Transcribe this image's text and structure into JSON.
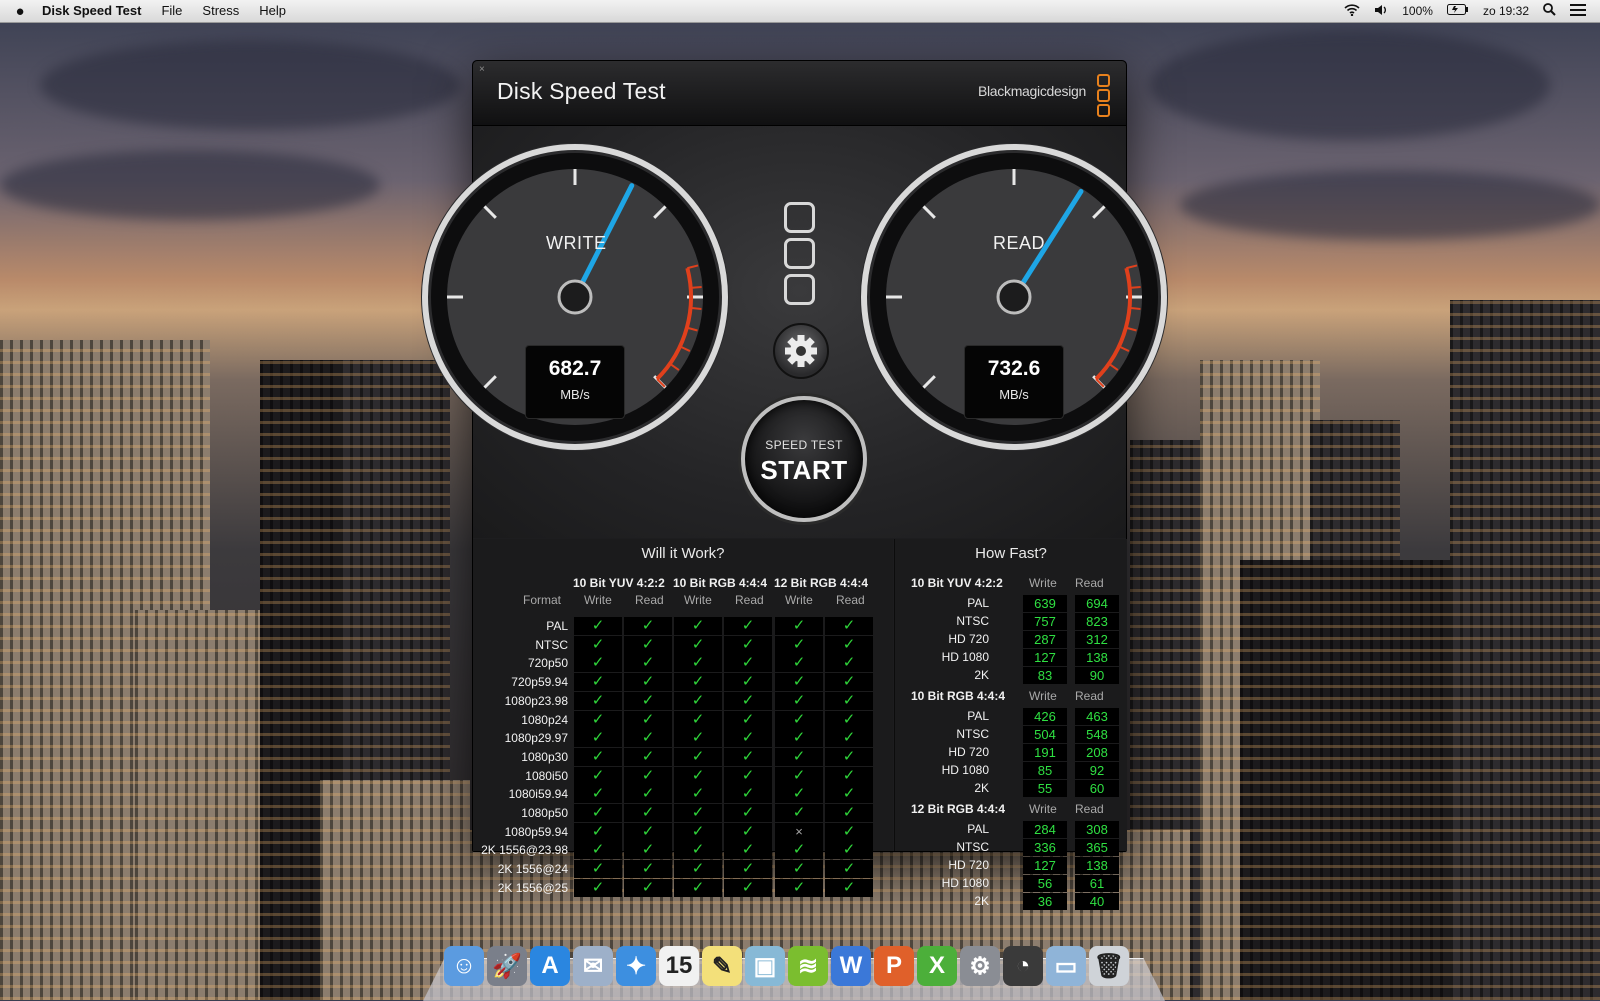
{
  "menubar": {
    "apple": "",
    "app_name": "Disk Speed Test",
    "menus": [
      "File",
      "Stress",
      "Help"
    ],
    "battery": "100%",
    "clock": "zo 19:32"
  },
  "window": {
    "close_glyph": "×",
    "title": "Disk Speed Test",
    "brand": "Blackmagicdesign",
    "accent_color": "#e8811d"
  },
  "gauges": {
    "write": {
      "label": "WRITE",
      "value": "682.7",
      "unit": "MB/s",
      "needle_fraction": 0.6
    },
    "read": {
      "label": "READ",
      "value": "732.6",
      "unit": "MB/s",
      "needle_fraction": 0.62
    }
  },
  "start_button": {
    "line1": "SPEED TEST",
    "line2": "START"
  },
  "will_it_work": {
    "title": "Will it Work?",
    "format_label": "Format",
    "groups": [
      "10 Bit YUV 4:2:2",
      "10 Bit RGB 4:4:4",
      "12 Bit RGB 4:4:4"
    ],
    "subcols": [
      "Write",
      "Read"
    ],
    "rows": [
      {
        "fmt": "PAL",
        "r": [
          1,
          1,
          1,
          1,
          1,
          1
        ]
      },
      {
        "fmt": "NTSC",
        "r": [
          1,
          1,
          1,
          1,
          1,
          1
        ]
      },
      {
        "fmt": "720p50",
        "r": [
          1,
          1,
          1,
          1,
          1,
          1
        ]
      },
      {
        "fmt": "720p59.94",
        "r": [
          1,
          1,
          1,
          1,
          1,
          1
        ]
      },
      {
        "fmt": "1080p23.98",
        "r": [
          1,
          1,
          1,
          1,
          1,
          1
        ]
      },
      {
        "fmt": "1080p24",
        "r": [
          1,
          1,
          1,
          1,
          1,
          1
        ]
      },
      {
        "fmt": "1080p29.97",
        "r": [
          1,
          1,
          1,
          1,
          1,
          1
        ]
      },
      {
        "fmt": "1080p30",
        "r": [
          1,
          1,
          1,
          1,
          1,
          1
        ]
      },
      {
        "fmt": "1080i50",
        "r": [
          1,
          1,
          1,
          1,
          1,
          1
        ]
      },
      {
        "fmt": "1080i59.94",
        "r": [
          1,
          1,
          1,
          1,
          1,
          1
        ]
      },
      {
        "fmt": "1080p50",
        "r": [
          1,
          1,
          1,
          1,
          1,
          1
        ]
      },
      {
        "fmt": "1080p59.94",
        "r": [
          1,
          1,
          1,
          1,
          0,
          1
        ]
      },
      {
        "fmt": "2K 1556@23.98",
        "r": [
          1,
          1,
          1,
          1,
          1,
          1
        ]
      },
      {
        "fmt": "2K 1556@24",
        "r": [
          1,
          1,
          1,
          1,
          1,
          1
        ]
      },
      {
        "fmt": "2K 1556@25",
        "r": [
          1,
          1,
          1,
          1,
          1,
          1
        ]
      }
    ],
    "ok_glyph": "✓",
    "fail_glyph": "×"
  },
  "how_fast": {
    "title": "How Fast?",
    "subcols": [
      "Write",
      "Read"
    ],
    "groups": [
      {
        "name": "10 Bit YUV 4:2:2",
        "rows": [
          {
            "fmt": "PAL",
            "w": "639",
            "r": "694"
          },
          {
            "fmt": "NTSC",
            "w": "757",
            "r": "823"
          },
          {
            "fmt": "HD 720",
            "w": "287",
            "r": "312"
          },
          {
            "fmt": "HD 1080",
            "w": "127",
            "r": "138"
          },
          {
            "fmt": "2K",
            "w": "83",
            "r": "90"
          }
        ]
      },
      {
        "name": "10 Bit RGB 4:4:4",
        "rows": [
          {
            "fmt": "PAL",
            "w": "426",
            "r": "463"
          },
          {
            "fmt": "NTSC",
            "w": "504",
            "r": "548"
          },
          {
            "fmt": "HD 720",
            "w": "191",
            "r": "208"
          },
          {
            "fmt": "HD 1080",
            "w": "85",
            "r": "92"
          },
          {
            "fmt": "2K",
            "w": "55",
            "r": "60"
          }
        ]
      },
      {
        "name": "12 Bit RGB 4:4:4",
        "rows": [
          {
            "fmt": "PAL",
            "w": "284",
            "r": "308"
          },
          {
            "fmt": "NTSC",
            "w": "336",
            "r": "365"
          },
          {
            "fmt": "HD 720",
            "w": "127",
            "r": "138"
          },
          {
            "fmt": "HD 1080",
            "w": "56",
            "r": "61"
          },
          {
            "fmt": "2K",
            "w": "36",
            "r": "40"
          }
        ]
      }
    ]
  },
  "dock": {
    "items": [
      {
        "name": "finder-icon",
        "glyph": "☺",
        "color": "#5b9be0"
      },
      {
        "name": "launchpad-icon",
        "glyph": "🚀",
        "color": "#7a7f8a"
      },
      {
        "name": "app-store-icon",
        "glyph": "A",
        "color": "#2a86e0"
      },
      {
        "name": "mail-icon",
        "glyph": "✉",
        "color": "#9db0c9"
      },
      {
        "name": "safari-icon",
        "glyph": "✦",
        "color": "#3d8fe0"
      },
      {
        "name": "calendar-icon",
        "glyph": "15",
        "color": "#f1f1f1"
      },
      {
        "name": "notes-icon",
        "glyph": "✎",
        "color": "#f3e07a"
      },
      {
        "name": "preview-icon",
        "glyph": "▣",
        "color": "#87b9d6"
      },
      {
        "name": "spotify-icon",
        "glyph": "≋",
        "color": "#7bbe2f"
      },
      {
        "name": "word-icon",
        "glyph": "W",
        "color": "#3b78d8"
      },
      {
        "name": "powerpoint-icon",
        "glyph": "P",
        "color": "#e0602a"
      },
      {
        "name": "excel-icon",
        "glyph": "X",
        "color": "#4caf3a"
      },
      {
        "name": "system-preferences-icon",
        "glyph": "⚙",
        "color": "#8a8d94"
      },
      {
        "name": "disk-speed-test-icon",
        "glyph": "◔",
        "color": "#3a3a3a"
      },
      {
        "name": "downloads-folder-icon",
        "glyph": "▭",
        "color": "#8fb4d8"
      },
      {
        "name": "trash-icon",
        "glyph": "🗑",
        "color": "#cfd3d8"
      }
    ]
  }
}
